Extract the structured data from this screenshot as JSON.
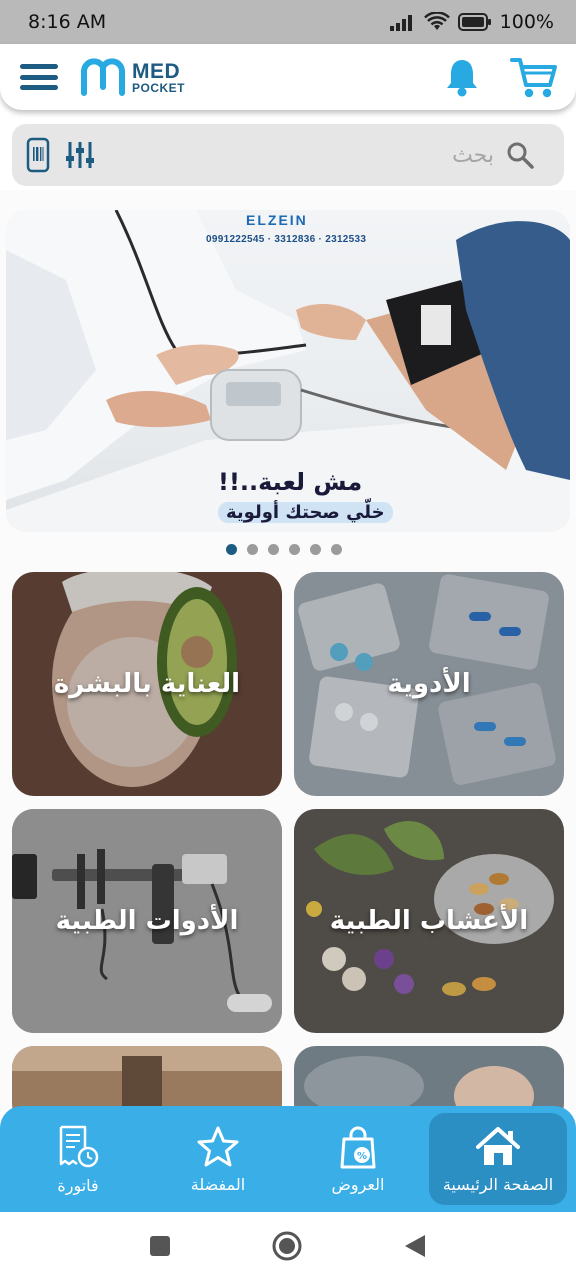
{
  "status_bar": {
    "time": "8:16 AM",
    "battery": "100%"
  },
  "header": {
    "logo_line1": "MED",
    "logo_line2": "POCKET",
    "icons": [
      "menu-icon",
      "bell-icon",
      "cart-icon"
    ]
  },
  "search": {
    "placeholder": "بحث",
    "icons": [
      "barcode-phone-icon",
      "filter-sliders-icon",
      "search-icon"
    ]
  },
  "banner": {
    "brand": "ELZEIN",
    "phones": "0991222545  ·  3312836  ·  2312533",
    "headline": "مش لعبة..!!",
    "subline": "خلّي صحتك أولوية",
    "slide_count": 6,
    "active_slide": 1
  },
  "categories": [
    {
      "label": "الأدوية"
    },
    {
      "label": "العناية بالبشرة"
    },
    {
      "label": "الأعشاب الطبية"
    },
    {
      "label": "الأدوات الطبية"
    },
    {
      "label": ""
    },
    {
      "label": ""
    }
  ],
  "bottom_nav": [
    {
      "label": "الصفحة الرئيسية",
      "icon": "home-icon",
      "active": true
    },
    {
      "label": "العروض",
      "icon": "offers-bag-icon",
      "active": false
    },
    {
      "label": "المفضلة",
      "icon": "star-icon",
      "active": false
    },
    {
      "label": "فاتورة",
      "icon": "invoice-icon",
      "active": false
    }
  ],
  "colors": {
    "brand_dark": "#1d5b83",
    "brand_accent": "#29a9e1",
    "nav_bg": "#3aaee6",
    "nav_active": "#2b8fc4",
    "search_bg": "#e6e6e6"
  }
}
